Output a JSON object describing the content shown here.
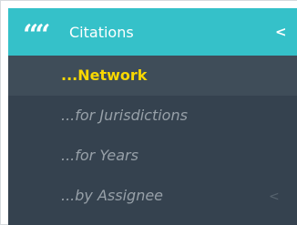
{
  "menu": {
    "header": {
      "icon": "quote-icon",
      "icon_glyph": "““",
      "label": "Citations",
      "chevron_glyph": "<"
    },
    "items": [
      {
        "label": "...Network",
        "active": true
      },
      {
        "label": "...for Jurisdictions",
        "active": false
      },
      {
        "label": "...for Years",
        "active": false
      },
      {
        "label": "...by Assignee",
        "active": false,
        "chevron_glyph": "<"
      }
    ]
  },
  "colors": {
    "header_bg": "#35c1c9",
    "submenu_bg": "#35424f",
    "active_item_bg": "#3f4d59",
    "active_text": "#f9d800",
    "inactive_text": "#97a0a8",
    "white": "#ffffff"
  }
}
